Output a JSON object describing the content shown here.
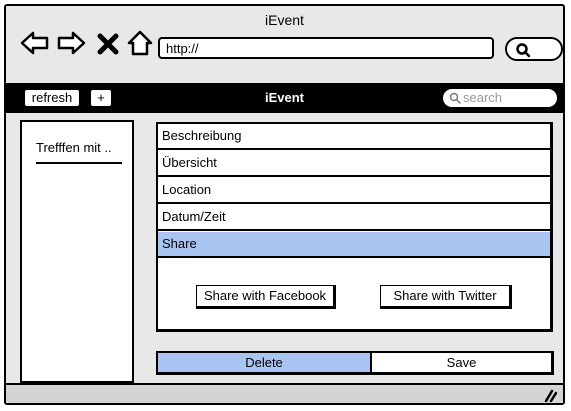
{
  "window": {
    "title": "iEvent"
  },
  "browser": {
    "url": "http://"
  },
  "toolbar": {
    "refresh_label": "refresh",
    "add_label": "+",
    "title": "iEvent",
    "search_placeholder": "search"
  },
  "sidebar": {
    "items": [
      {
        "label": "Trefffen mit .."
      }
    ]
  },
  "sections": [
    {
      "label": "Beschreibung"
    },
    {
      "label": "Übersicht"
    },
    {
      "label": "Location"
    },
    {
      "label": "Datum/Zeit"
    },
    {
      "label": "Share"
    }
  ],
  "share": {
    "facebook_label": "Share with Facebook",
    "twitter_label": "Share with Twitter"
  },
  "actions": {
    "delete_label": "Delete",
    "save_label": "Save"
  },
  "colors": {
    "selected": "#a9c4f1",
    "toolbar": "#000000",
    "chrome": "#e8e8e8"
  }
}
